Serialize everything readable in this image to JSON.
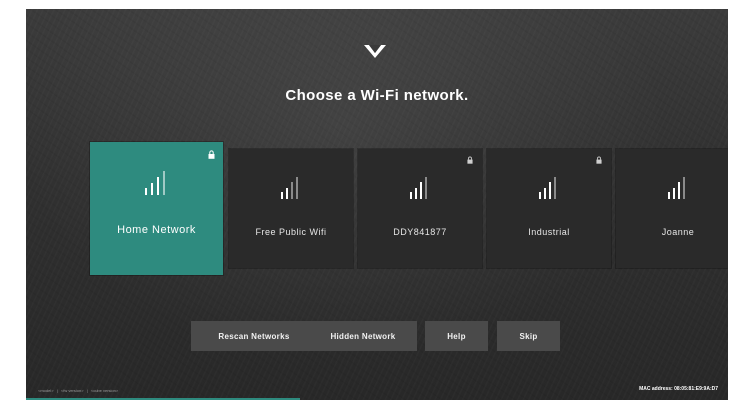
{
  "header": {
    "title": "Choose a Wi-Fi network.",
    "logo_icon": "vizio-v-logo-icon"
  },
  "networks": [
    {
      "name": "Home Network",
      "locked": true,
      "selected": true
    },
    {
      "name": "Free Public Wifi",
      "locked": false,
      "selected": false
    },
    {
      "name": "DDY841877",
      "locked": true,
      "selected": false
    },
    {
      "name": "Industrial",
      "locked": true,
      "selected": false
    },
    {
      "name": "Joanne",
      "locked": false,
      "selected": false
    }
  ],
  "buttons": {
    "rescan": "Rescan Networks",
    "hidden": "Hidden Network",
    "help": "Help",
    "skip": "Skip"
  },
  "footer": {
    "model": "<model>",
    "separator": "|",
    "fw_version": "<fw version>",
    "cube_version": "<cube version>",
    "mac_address": "MAC address: 08:05:81:E9:9A:D7"
  },
  "progress": {
    "fraction": 0.39
  },
  "colors": {
    "accent": "#2e8b7f",
    "tile": "#2a2a2a",
    "button": "#4a4a4a",
    "text": "#ffffff"
  }
}
